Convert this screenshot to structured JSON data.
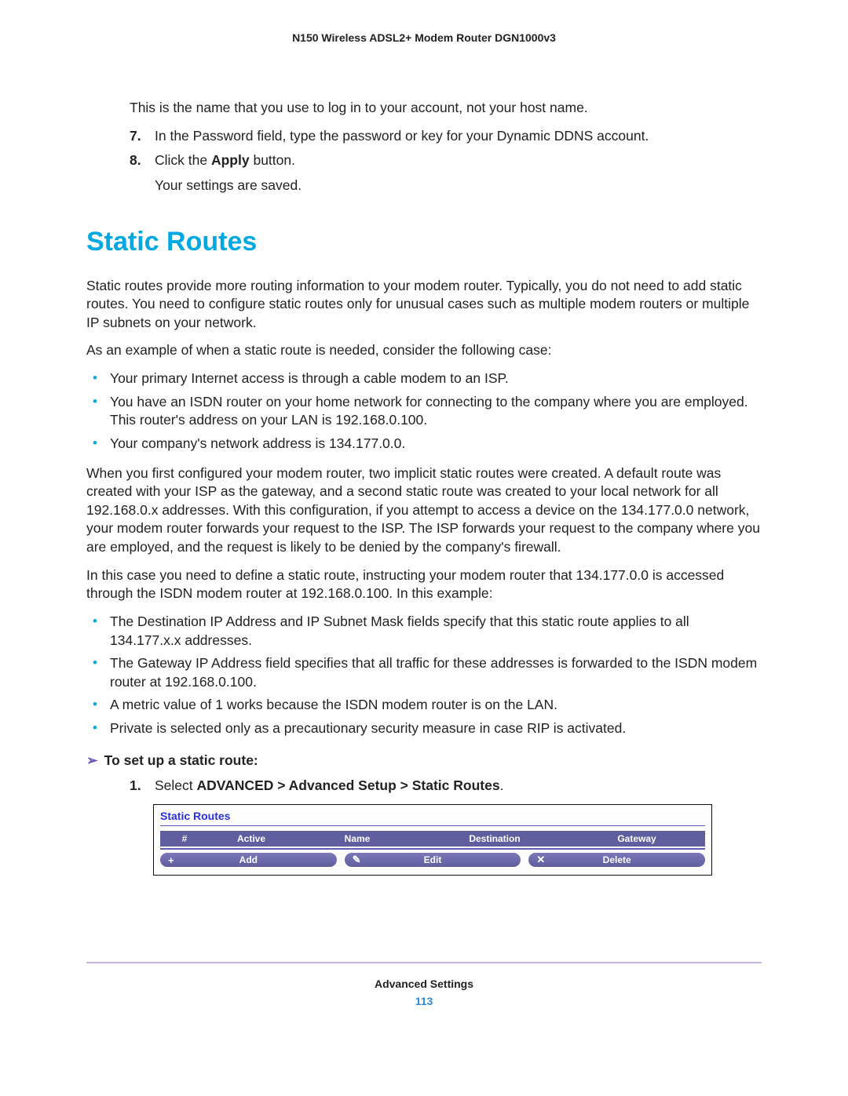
{
  "header": {
    "title": "N150 Wireless ADSL2+ Modem Router DGN1000v3"
  },
  "intro": {
    "line1": "This is the name that you use to log in to your account, not your host name.",
    "step7": {
      "num": "7.",
      "text": "In the Password field, type the password or key for your Dynamic DDNS account."
    },
    "step8": {
      "num": "8.",
      "pre": "Click the ",
      "bold": "Apply",
      "post": " button.",
      "sub": "Your settings are saved."
    }
  },
  "section": {
    "title": "Static Routes",
    "p1": "Static routes provide more routing information to your modem router. Typically, you do not need to add static routes. You need to configure static routes only for unusual cases such as multiple modem routers or multiple IP subnets on your network.",
    "p2": "As an example of when a static route is needed, consider the following case:",
    "bullets1": [
      "Your primary Internet access is through a cable modem to an ISP.",
      "You have an ISDN router on your home network for connecting to the company where you are employed. This router's address on your LAN is 192.168.0.100.",
      "Your company's network address is 134.177.0.0."
    ],
    "p3": "When you first configured your modem router, two implicit static routes were created. A default route was created with your ISP as the gateway, and a second static route was created to your local network for all 192.168.0.x addresses. With this configuration, if you attempt to access a device on the 134.177.0.0 network, your modem router forwards your request to the ISP. The ISP forwards your request to the company where you are employed, and the request is likely to be denied by the company's firewall.",
    "p4": "In this case you need to define a static route, instructing your modem router that 134.177.0.0 is accessed through the ISDN modem router at 192.168.0.100. In this example:",
    "bullets2": [
      "The Destination IP Address and IP Subnet Mask fields specify that this static route applies to all 134.177.x.x addresses.",
      "The Gateway IP Address field specifies that all traffic for these addresses is forwarded to the ISDN modem router at 192.168.0.100.",
      "A metric value of 1 works because the ISDN modem router is on the LAN.",
      "Private is selected only as a precautionary security measure in case RIP is activated."
    ],
    "task": {
      "arrow": "➢",
      "title": "To set up a static route:",
      "step1": {
        "num": "1.",
        "pre": "Select ",
        "bold": "ADVANCED > Advanced Setup > Static Routes",
        "post": "."
      }
    }
  },
  "screenshot": {
    "title": "Static Routes",
    "cols": [
      "#",
      "Active",
      "Name",
      "Destination",
      "Gateway"
    ],
    "buttons": {
      "add": {
        "icon": "+",
        "label": "Add"
      },
      "edit": {
        "icon": "✎",
        "label": "Edit"
      },
      "delete": {
        "icon": "✕",
        "label": "Delete"
      }
    }
  },
  "footer": {
    "section": "Advanced Settings",
    "page": "113"
  }
}
